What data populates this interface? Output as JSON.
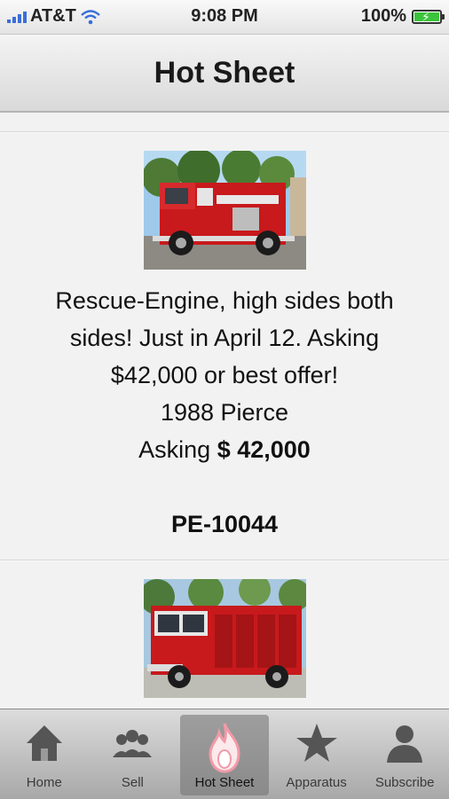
{
  "status": {
    "carrier": "AT&T",
    "time": "9:08 PM",
    "battery": "100%"
  },
  "header": {
    "title": "Hot Sheet"
  },
  "listings": [
    {
      "description": "Rescue-Engine, high sides both sides! Just in April 12. Asking $42,000 or best offer!",
      "model": "1988 Pierce",
      "asking_label": "Asking",
      "price": "$ 42,000",
      "stock": "PE-10044"
    }
  ],
  "tabs": [
    {
      "label": "Home",
      "icon": "home-icon"
    },
    {
      "label": "Sell",
      "icon": "people-icon"
    },
    {
      "label": "Hot Sheet",
      "icon": "flame-icon"
    },
    {
      "label": "Apparatus",
      "icon": "star-icon"
    },
    {
      "label": "Subscribe",
      "icon": "person-icon"
    }
  ],
  "colors": {
    "battery": "#3bc43b",
    "signal": "#3a6fd8",
    "truck_red": "#c8191c"
  }
}
